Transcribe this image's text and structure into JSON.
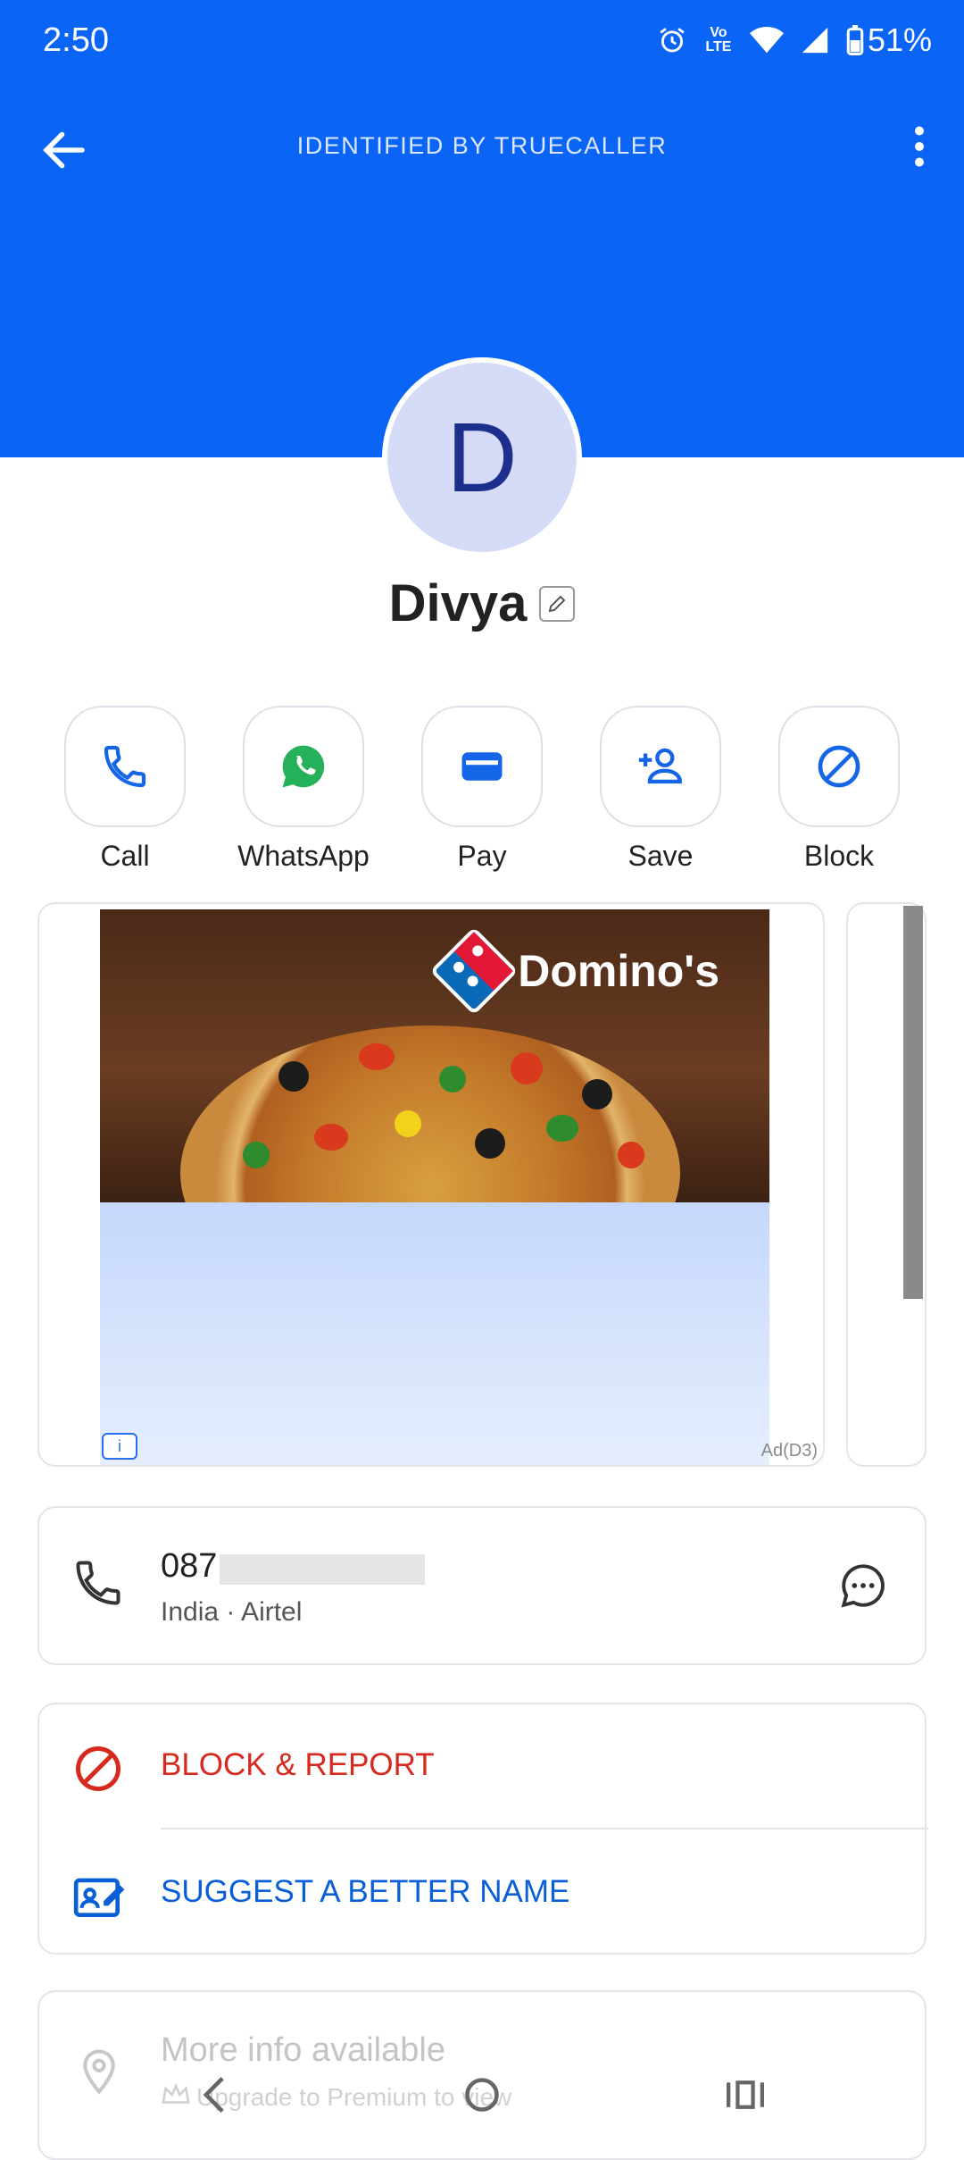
{
  "status_bar": {
    "time": "2:50",
    "battery": "51%",
    "volte": "Vo LTE"
  },
  "toolbar": {
    "title": "IDENTIFIED BY TRUECALLER"
  },
  "contact": {
    "initial": "D",
    "name": "Divya"
  },
  "actions": [
    {
      "label": "Call",
      "icon": "phone-icon"
    },
    {
      "label": "WhatsApp",
      "icon": "whatsapp-icon"
    },
    {
      "label": "Pay",
      "icon": "wallet-icon"
    },
    {
      "label": "Save",
      "icon": "add-contact-icon"
    },
    {
      "label": "Block",
      "icon": "block-icon"
    }
  ],
  "ad": {
    "brand": "Domino's",
    "label": "Ad(D3)",
    "info_icon": "i"
  },
  "phone": {
    "number": "087",
    "details": "India · Airtel"
  },
  "options": {
    "block_report": "BLOCK & REPORT",
    "suggest_name": "SUGGEST A BETTER NAME"
  },
  "more_info": {
    "title": "More info available",
    "subtitle": "Upgrade to Premium to view"
  },
  "colors": {
    "header_blue": "#0a64f5",
    "danger_red": "#d72a1f",
    "link_blue": "#0a5fd8",
    "whatsapp_green": "#25b15a"
  }
}
